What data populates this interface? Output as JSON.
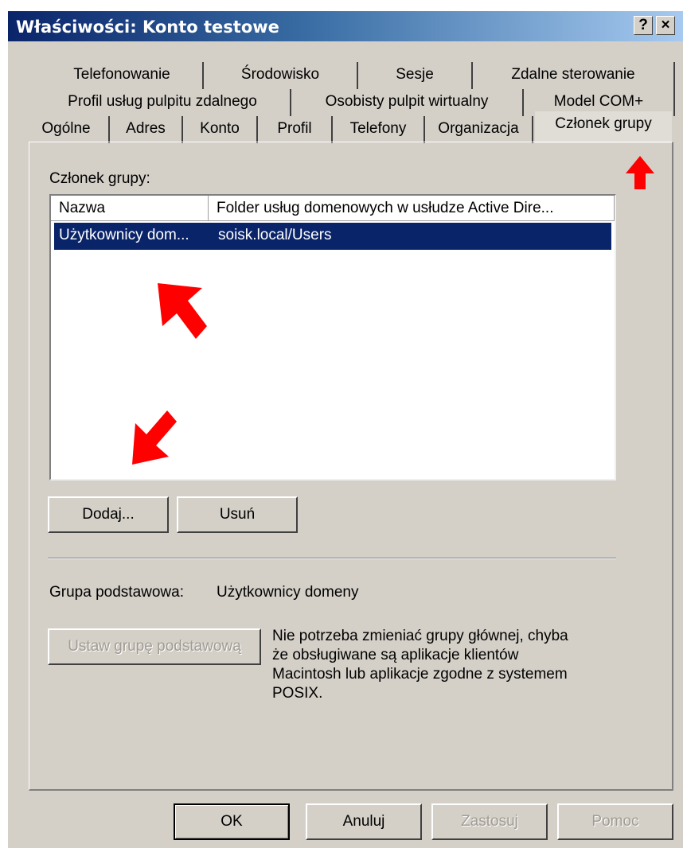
{
  "window": {
    "title": "Właściwości: Konto testowe",
    "help_label": "?",
    "close_label": "×"
  },
  "tabs": {
    "row1": [
      "Telefonowanie",
      "Środowisko",
      "Sesje",
      "Zdalne sterowanie"
    ],
    "row2": [
      "Profil usług pulpitu zdalnego",
      "Osobisty pulpit wirtualny",
      "Model COM+"
    ],
    "row3": [
      "Ogólne",
      "Adres",
      "Konto",
      "Profil",
      "Telefony",
      "Organizacja",
      "Członek grupy"
    ],
    "selected": "Członek grupy"
  },
  "member_of": {
    "label": "Członek grupy:",
    "columns": [
      "Nazwa",
      "Folder usług domenowych w usłudze Active Dire..."
    ],
    "rows": [
      {
        "name": "Użytkownicy dom...",
        "folder": "soisk.local/Users",
        "selected": true
      }
    ],
    "add_label": "Dodaj...",
    "remove_label": "Usuń"
  },
  "primary_group": {
    "label": "Grupa podstawowa:",
    "value": "Użytkownicy domeny",
    "set_label": "Ustaw grupę podstawową",
    "info_lines": [
      "Nie potrzeba zmieniać grupy głównej, chyba",
      "że obsługiwane są aplikacje klientów",
      "Macintosh lub aplikacje zgodne z systemem",
      "POSIX."
    ]
  },
  "footer": {
    "ok_label": "OK",
    "cancel_label": "Anuluj",
    "apply_label": "Zastosuj",
    "help_label": "Pomoc"
  },
  "colors": {
    "title_gradient_start": "#0a246a",
    "selection": "#0a246a",
    "dialog_face": "#d4d0c8",
    "annotation_arrow": "#ff0000"
  }
}
